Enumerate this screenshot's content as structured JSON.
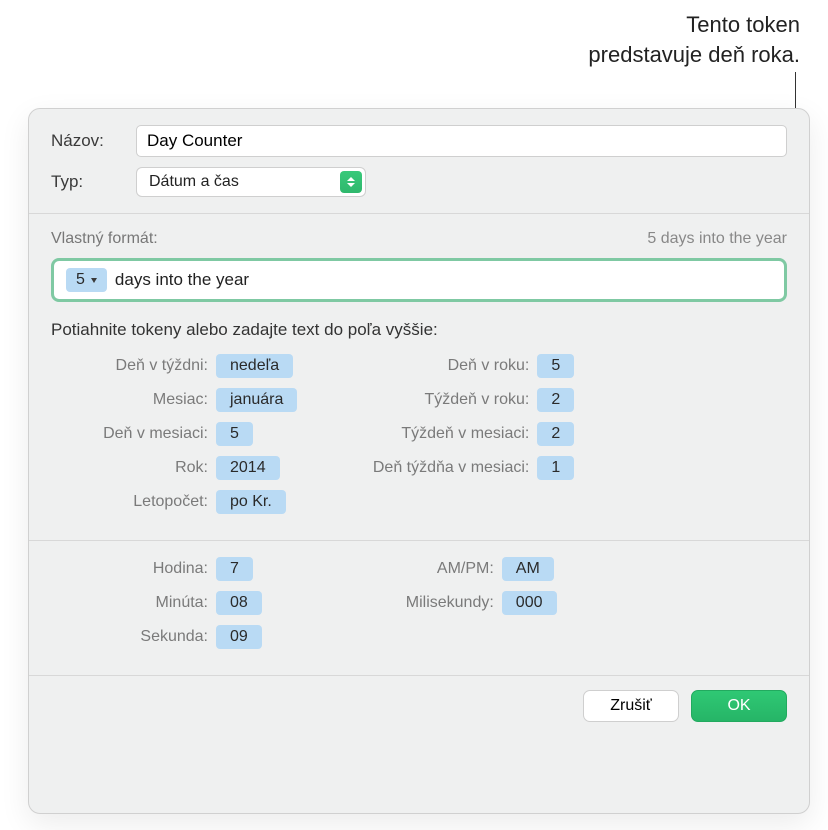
{
  "callout": {
    "line1": "Tento token",
    "line2": "predstavuje deň roka."
  },
  "labels": {
    "name": "Názov:",
    "type": "Typ:",
    "customFormat": "Vlastný formát:",
    "instruction": "Potiahnite tokeny alebo zadajte text do poľa vyššie:"
  },
  "values": {
    "name": "Day Counter",
    "type": "Dátum a čas",
    "preview": "5 days into the year",
    "formatTokenValue": "5",
    "formatText": "days into the year"
  },
  "tokens": {
    "left": [
      {
        "label": "Deň v týždni:",
        "value": "nedeľa"
      },
      {
        "label": "Mesiac:",
        "value": "januára"
      },
      {
        "label": "Deň v mesiaci:",
        "value": "5"
      },
      {
        "label": "Rok:",
        "value": "2014"
      },
      {
        "label": "Letopočet:",
        "value": "po Kr."
      }
    ],
    "right": [
      {
        "label": "Deň v roku:",
        "value": "5"
      },
      {
        "label": "Týždeň v roku:",
        "value": "2"
      },
      {
        "label": "Týždeň v mesiaci:",
        "value": "2"
      },
      {
        "label": "Deň týždňa v mesiaci:",
        "value": "1"
      }
    ],
    "timeLeft": [
      {
        "label": "Hodina:",
        "value": "7"
      },
      {
        "label": "Minúta:",
        "value": "08"
      },
      {
        "label": "Sekunda:",
        "value": "09"
      }
    ],
    "timeRight": [
      {
        "label": "AM/PM:",
        "value": "AM"
      },
      {
        "label": "Milisekundy:",
        "value": "000"
      }
    ]
  },
  "buttons": {
    "cancel": "Zrušiť",
    "ok": "OK"
  }
}
